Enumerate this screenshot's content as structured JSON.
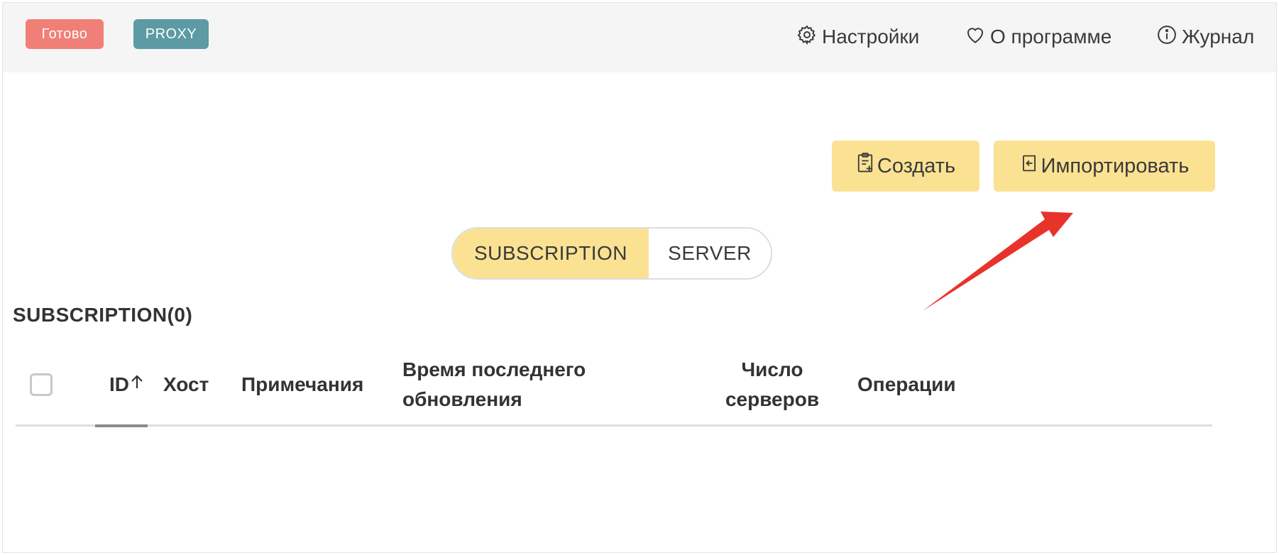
{
  "header": {
    "status_badge": "Готово",
    "mode_badge": "PROXY",
    "nav": {
      "settings": "Настройки",
      "about": "О программе",
      "log": "Журнал"
    }
  },
  "actions": {
    "create_label": "Создать",
    "import_label": "Импортировать"
  },
  "segmented": {
    "options": [
      "SUBSCRIPTION",
      "SERVER"
    ],
    "selected": "SUBSCRIPTION"
  },
  "section": {
    "title": "SUBSCRIPTION(0)"
  },
  "table": {
    "columns": {
      "id": "ID",
      "host": "Хост",
      "notes": "Примечания",
      "last_update_line1": "Время последнего",
      "last_update_line2": "обновления",
      "server_count_line1": "Число",
      "server_count_line2": "серверов",
      "operations": "Операции"
    },
    "sort": {
      "column": "ID",
      "direction": "ascending"
    },
    "rows": []
  },
  "colors": {
    "accent_yellow": "#fbe293",
    "status_red": "#f07f77",
    "mode_teal": "#5c9aa4",
    "annotation_arrow": "#e8332a"
  }
}
